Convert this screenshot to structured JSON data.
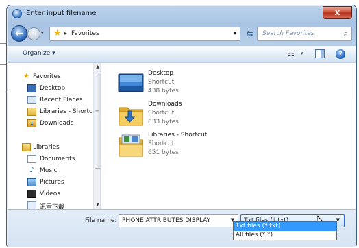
{
  "window": {
    "title": "Enter input filename",
    "close_label": "x"
  },
  "nav": {
    "breadcrumb_sep": "▸",
    "path": "Favorites",
    "search_placeholder": "Search Favorites"
  },
  "toolbar": {
    "organize_label": "Organize ▾"
  },
  "sidebar": {
    "items": [
      {
        "label": "Favorites",
        "icon": "star-icon"
      },
      {
        "label": "Desktop",
        "icon": "desktop-icon"
      },
      {
        "label": "Recent Places",
        "icon": "recent-places-icon"
      },
      {
        "label": "Libraries - Shortc",
        "icon": "library-icon"
      },
      {
        "label": "Downloads",
        "icon": "downloads-icon"
      },
      {
        "label": "Libraries",
        "icon": "library-icon"
      },
      {
        "label": "Documents",
        "icon": "documents-icon"
      },
      {
        "label": "Music",
        "icon": "music-icon"
      },
      {
        "label": "Pictures",
        "icon": "pictures-icon"
      },
      {
        "label": "Videos",
        "icon": "videos-icon"
      },
      {
        "label": "讯雷下载",
        "icon": "folder-icon"
      }
    ]
  },
  "files": [
    {
      "name": "Desktop",
      "type": "Shortcut",
      "size": "438 bytes"
    },
    {
      "name": "Downloads",
      "type": "Shortcut",
      "size": "833 bytes"
    },
    {
      "name": "Libraries - Shortcut",
      "type": "Shortcut",
      "size": "651 bytes"
    }
  ],
  "bottom": {
    "filename_label": "File name:",
    "filename_value": "PHONE ATTRIBUTES DISPLAY",
    "filetype_value": "Txt files (*.txt)",
    "filetype_options": [
      "Txt files (*.txt)",
      "All files (*.*)"
    ]
  }
}
